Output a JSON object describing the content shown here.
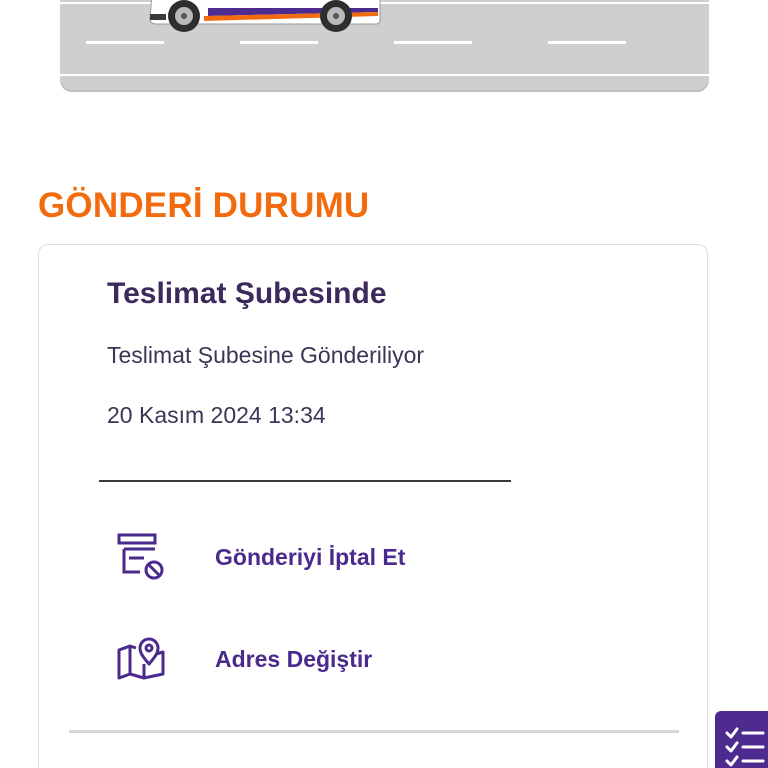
{
  "illustration": {
    "icon": "delivery-van-illustration",
    "colors": {
      "road": "#cfcfcf",
      "van_body": "#ffffff",
      "van_stripe_orange": "#f26b0f",
      "van_stripe_purple": "#4d2b8f"
    }
  },
  "shipment_status": {
    "heading": "GÖNDERİ DURUMU",
    "status_title": "Teslimat Şubesinde",
    "status_description": "Teslimat Şubesine Gönderiliyor",
    "status_date": "20 Kasım 2024 13:34"
  },
  "actions": [
    {
      "label": "Gönderiyi İptal Et",
      "icon": "cancel-shipment-icon"
    },
    {
      "label": "Adres Değiştir",
      "icon": "map-pin-icon"
    }
  ],
  "fab": {
    "icon": "checklist-icon"
  },
  "colors": {
    "accent_orange": "#f26b0f",
    "brand_purple": "#4d2b8f",
    "title_text": "#3c2a5c"
  }
}
